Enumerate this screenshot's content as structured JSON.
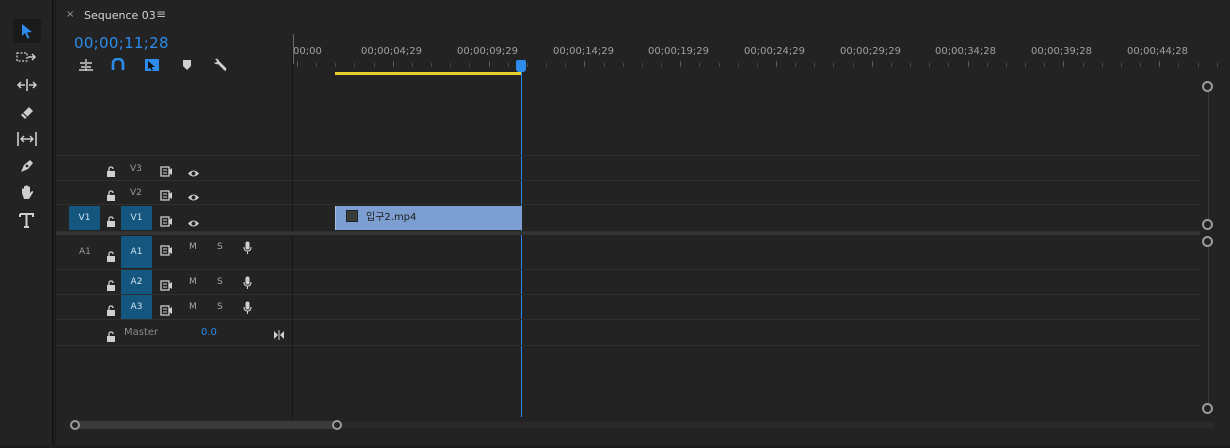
{
  "tab": {
    "close": "×",
    "title": "Sequence 03",
    "menu": "≡"
  },
  "timecode": "00;00;11;28",
  "ruler": {
    "labels": [
      "00;00",
      "00;00;04;29",
      "00;00;09;29",
      "00;00;14;29",
      "00;00;19;29",
      "00;00;24;29",
      "00;00;29;29",
      "00;00;34;28",
      "00;00;39;28",
      "00;00;44;28"
    ]
  },
  "tools": [
    "selection-tool",
    "track-select-forward-tool",
    "ripple-edit-tool",
    "razor-tool",
    "slip-tool",
    "pen-tool",
    "hand-tool",
    "type-tool"
  ],
  "controls": [
    "insert-nested-icon",
    "snap-icon",
    "linked-selection-icon",
    "add-marker-icon",
    "settings-wrench-icon"
  ],
  "video_tracks": [
    {
      "name": "V3",
      "source": ""
    },
    {
      "name": "V2",
      "source": ""
    },
    {
      "name": "V1",
      "source": "V1"
    }
  ],
  "audio_tracks": [
    {
      "name": "A1",
      "source": "A1",
      "m": "M",
      "s": "S"
    },
    {
      "name": "A2",
      "source": "",
      "m": "M",
      "s": "S"
    },
    {
      "name": "A3",
      "source": "",
      "m": "M",
      "s": "S"
    }
  ],
  "master": {
    "label": "Master",
    "value": "0.0"
  },
  "clip": {
    "name": "입구2.mp4"
  },
  "colors": {
    "accent": "#2d8ceb",
    "patch": "#14567d",
    "clip": "#7d9ed0",
    "workarea": "#e6d12a"
  }
}
